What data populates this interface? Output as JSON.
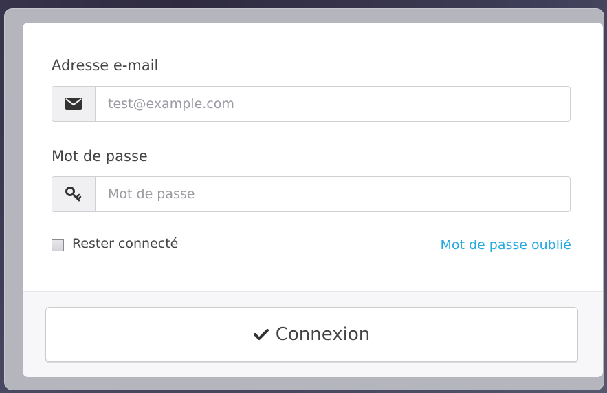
{
  "login_form": {
    "email_label": "Adresse e-mail",
    "email_placeholder": "test@example.com",
    "email_icon": "envelope-icon",
    "password_label": "Mot de passe",
    "password_placeholder": "Mot de passe",
    "password_icon": "key-icon",
    "remember_label": "Rester connecté",
    "remember_checked": false,
    "forgot_link": "Mot de passe oublié",
    "submit_label": "Connexion",
    "submit_icon": "check-icon"
  },
  "colors": {
    "link": "#25a9e0",
    "text": "#444444",
    "addon_bg": "#f0f0f2"
  }
}
